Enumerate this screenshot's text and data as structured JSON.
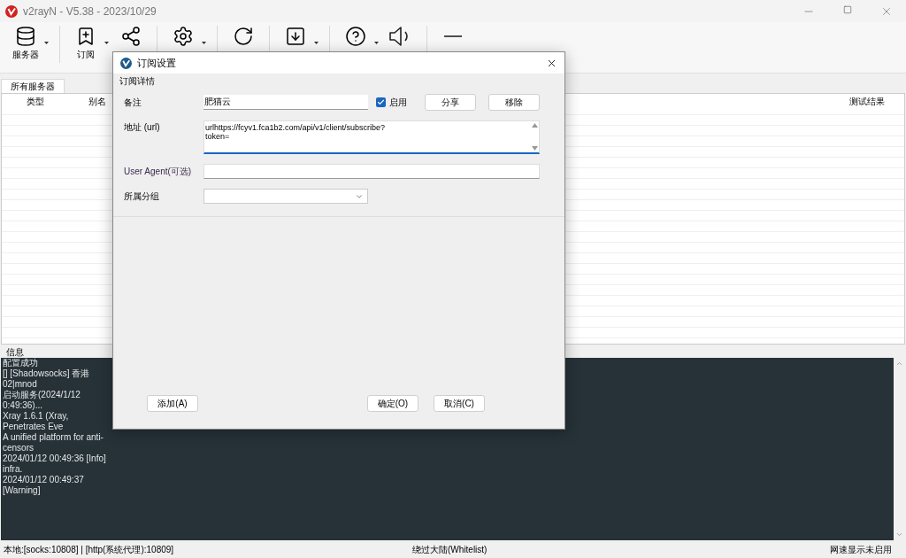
{
  "window": {
    "title": "v2rayN - V5.38 - 2023/10/29"
  },
  "toolbar": [
    {
      "label": "服务器",
      "dropdown": true
    },
    {
      "label": "订阅",
      "dropdown": true
    },
    {
      "dropdown": false
    },
    {
      "dropdown": true
    },
    {
      "dropdown": false
    },
    {
      "dropdown": true
    },
    {
      "dropdown": true
    },
    {
      "dropdown": false
    },
    {
      "dropdown": false
    }
  ],
  "tabs": [
    {
      "label": "所有服务器",
      "selected": true
    }
  ],
  "table": {
    "columns": [
      "类型",
      "别名",
      "测试结果"
    ]
  },
  "info": {
    "title": "信息",
    "log": [
      "配置成功",
      "[] [Shadowsocks] 香港 02|mnod",
      "启动服务(2024/1/12 0:49:36)...",
      "Xray 1.6.1 (Xray, Penetrates Eve",
      "A unified platform for anti-censors",
      "2024/01/12 00:49:36 [Info] infra.",
      "2024/01/12 00:49:37 [Warning]"
    ]
  },
  "status_bar": {
    "left": "本地:[socks:10808] | [http(系统代理):10809]",
    "center": "绕过大陆(Whitelist)",
    "right": "网速显示未启用"
  },
  "dialog": {
    "title": "订阅设置",
    "group": "订阅详情",
    "remark": {
      "label": "备注",
      "value": "肥猫云"
    },
    "enabled": {
      "label": "启用",
      "checked": true
    },
    "share_button": "分享",
    "remove_button": "移除",
    "url": {
      "label": "地址 (url)",
      "value": "urlhttps://fcyv1.fca1b2.com/api/v1/client/subscribe?\ntoken="
    },
    "user_agent": {
      "label": "User Agent(可选)"
    },
    "group_select": {
      "label": "所属分组"
    },
    "add_button": "添加(A)",
    "ok_button": "确定(O)",
    "cancel_button": "取消(C)"
  }
}
